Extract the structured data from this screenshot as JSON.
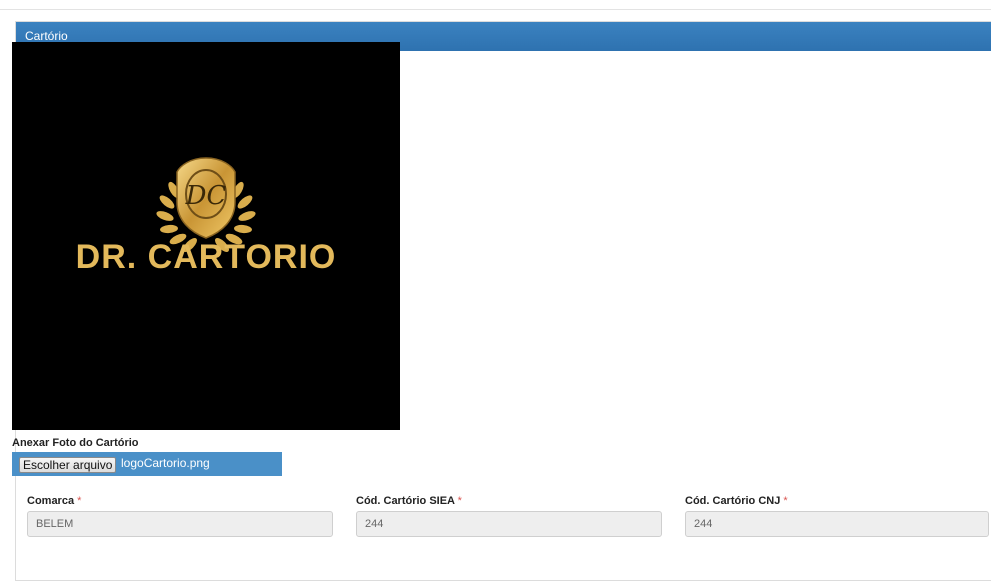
{
  "panel": {
    "title": "Cartório"
  },
  "logo": {
    "text": "DR. CARTORIO",
    "emblem_letters": "DC",
    "colors": {
      "background": "#000000",
      "gold": "#e3b95b"
    }
  },
  "attachment": {
    "label": "Anexar Foto do Cartório",
    "button_label": "Escolher arquivo",
    "file_name": "logoCartorio.png"
  },
  "fields": {
    "comarca": {
      "label": "Comarca",
      "required": "*",
      "value": "BELEM"
    },
    "cod_siea": {
      "label": "Cód. Cartório SIEA",
      "required": "*",
      "value": "244"
    },
    "cod_cnj": {
      "label": "Cód. Cartório CNJ",
      "required": "*",
      "value": "244"
    }
  },
  "colors": {
    "header": "#3278b7",
    "file_input_bg": "#4a90c8",
    "required_star": "#d9534f"
  }
}
